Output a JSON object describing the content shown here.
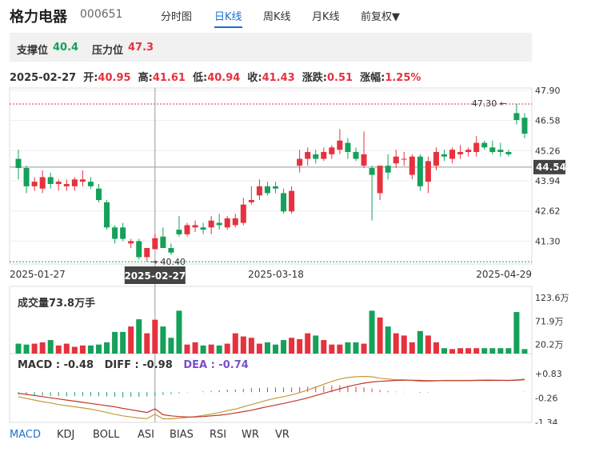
{
  "header": {
    "name": "格力电器",
    "code": "000651",
    "tabs": [
      "分时图",
      "日K线",
      "周K线",
      "月K线",
      "前复权▼"
    ],
    "active_tab": 1
  },
  "levels": {
    "support_label": "支撑位",
    "support_value": "40.4",
    "resistance_label": "压力位",
    "resistance_value": "47.3"
  },
  "info": {
    "date": "2025-02-27",
    "open_label": "开:",
    "open": "40.95",
    "high_label": "高:",
    "high": "41.61",
    "low_label": "低:",
    "low": "40.94",
    "close_label": "收:",
    "close": "41.43",
    "change_label": "涨跌:",
    "change": "0.51",
    "pct_label": "涨幅:",
    "pct": "1.25%"
  },
  "colors": {
    "up": "#e5323e",
    "down": "#15a15a",
    "dif": "#c49a3a",
    "dea": "#c0392b",
    "accent": "#1f6fd1"
  },
  "chart_data": [
    {
      "type": "candlestick",
      "y_ticks": [
        "47.90",
        "46.58",
        "45.26",
        "43.94",
        "42.62",
        "41.30"
      ],
      "ylim": [
        40.3,
        48.0
      ],
      "x_labels": [
        "2025-01-27",
        "2025-03-18",
        "2025-04-29"
      ],
      "crosshair_date": "2025-02-27",
      "crosshair_price": "44.54",
      "max_label": "47.30",
      "min_label": "40.40",
      "candles": [
        {
          "o": 44.9,
          "h": 45.3,
          "l": 44.0,
          "c": 44.5
        },
        {
          "o": 44.5,
          "h": 44.6,
          "l": 43.4,
          "c": 43.7
        },
        {
          "o": 43.7,
          "h": 44.1,
          "l": 43.5,
          "c": 43.9
        },
        {
          "o": 43.6,
          "h": 44.4,
          "l": 43.4,
          "c": 44.1
        },
        {
          "o": 44.1,
          "h": 44.3,
          "l": 43.6,
          "c": 43.8
        },
        {
          "o": 43.8,
          "h": 44.0,
          "l": 43.5,
          "c": 43.9
        },
        {
          "o": 43.7,
          "h": 44.0,
          "l": 43.5,
          "c": 43.8
        },
        {
          "o": 43.7,
          "h": 44.1,
          "l": 43.5,
          "c": 44.0
        },
        {
          "o": 43.9,
          "h": 44.4,
          "l": 43.7,
          "c": 44.0
        },
        {
          "o": 43.9,
          "h": 44.1,
          "l": 43.6,
          "c": 43.7
        },
        {
          "o": 43.6,
          "h": 43.8,
          "l": 43.0,
          "c": 43.1
        },
        {
          "o": 43.0,
          "h": 43.1,
          "l": 41.8,
          "c": 41.9
        },
        {
          "o": 41.9,
          "h": 42.0,
          "l": 41.2,
          "c": 41.4
        },
        {
          "o": 41.9,
          "h": 42.1,
          "l": 41.3,
          "c": 41.4
        },
        {
          "o": 41.2,
          "h": 41.4,
          "l": 41.0,
          "c": 41.3
        },
        {
          "o": 41.3,
          "h": 41.4,
          "l": 40.5,
          "c": 40.6
        },
        {
          "o": 40.6,
          "h": 41.0,
          "l": 40.4,
          "c": 41.0
        },
        {
          "o": 40.95,
          "h": 41.61,
          "l": 40.94,
          "c": 41.43
        },
        {
          "o": 41.5,
          "h": 41.9,
          "l": 41.0,
          "c": 41.0
        },
        {
          "o": 41.0,
          "h": 41.2,
          "l": 40.7,
          "c": 40.8
        },
        {
          "o": 41.8,
          "h": 42.4,
          "l": 41.5,
          "c": 41.6
        },
        {
          "o": 41.6,
          "h": 42.1,
          "l": 41.5,
          "c": 42.0
        },
        {
          "o": 41.9,
          "h": 42.2,
          "l": 41.7,
          "c": 42.0
        },
        {
          "o": 41.9,
          "h": 42.1,
          "l": 41.6,
          "c": 41.8
        },
        {
          "o": 41.9,
          "h": 42.4,
          "l": 41.6,
          "c": 42.2
        },
        {
          "o": 42.1,
          "h": 42.5,
          "l": 41.8,
          "c": 42.0
        },
        {
          "o": 41.9,
          "h": 42.4,
          "l": 41.8,
          "c": 42.3
        },
        {
          "o": 42.0,
          "h": 42.5,
          "l": 41.9,
          "c": 42.3
        },
        {
          "o": 42.1,
          "h": 43.2,
          "l": 42.0,
          "c": 42.9
        },
        {
          "o": 43.0,
          "h": 43.7,
          "l": 42.9,
          "c": 43.1
        },
        {
          "o": 43.3,
          "h": 44.0,
          "l": 43.1,
          "c": 43.7
        },
        {
          "o": 43.7,
          "h": 43.9,
          "l": 43.3,
          "c": 43.4
        },
        {
          "o": 43.7,
          "h": 43.9,
          "l": 43.4,
          "c": 43.6
        },
        {
          "o": 43.4,
          "h": 43.6,
          "l": 42.5,
          "c": 42.6
        },
        {
          "o": 42.6,
          "h": 43.7,
          "l": 42.5,
          "c": 43.5
        },
        {
          "o": 44.6,
          "h": 45.3,
          "l": 44.3,
          "c": 44.9
        },
        {
          "o": 44.9,
          "h": 45.4,
          "l": 44.6,
          "c": 45.2
        },
        {
          "o": 45.1,
          "h": 45.3,
          "l": 44.7,
          "c": 44.9
        },
        {
          "o": 44.9,
          "h": 45.4,
          "l": 44.8,
          "c": 45.2
        },
        {
          "o": 45.1,
          "h": 45.5,
          "l": 44.9,
          "c": 45.4
        },
        {
          "o": 45.3,
          "h": 46.2,
          "l": 45.1,
          "c": 45.7
        },
        {
          "o": 45.6,
          "h": 45.8,
          "l": 44.9,
          "c": 45.2
        },
        {
          "o": 45.2,
          "h": 45.4,
          "l": 44.8,
          "c": 44.9
        },
        {
          "o": 44.6,
          "h": 46.1,
          "l": 44.5,
          "c": 45.1
        },
        {
          "o": 44.5,
          "h": 44.6,
          "l": 42.2,
          "c": 44.2
        },
        {
          "o": 43.4,
          "h": 44.5,
          "l": 43.1,
          "c": 44.6
        },
        {
          "o": 44.6,
          "h": 45.1,
          "l": 44.0,
          "c": 44.3
        },
        {
          "o": 44.7,
          "h": 45.3,
          "l": 44.5,
          "c": 45.0
        },
        {
          "o": 44.9,
          "h": 45.2,
          "l": 44.6,
          "c": 44.9
        },
        {
          "o": 44.2,
          "h": 45.1,
          "l": 44.0,
          "c": 45.0
        },
        {
          "o": 45.0,
          "h": 45.1,
          "l": 43.5,
          "c": 43.7
        },
        {
          "o": 43.9,
          "h": 45.0,
          "l": 43.4,
          "c": 44.8
        },
        {
          "o": 44.6,
          "h": 45.4,
          "l": 44.4,
          "c": 45.2
        },
        {
          "o": 45.1,
          "h": 45.3,
          "l": 44.8,
          "c": 45.0
        },
        {
          "o": 44.9,
          "h": 45.4,
          "l": 44.7,
          "c": 45.3
        },
        {
          "o": 45.1,
          "h": 45.5,
          "l": 44.9,
          "c": 45.2
        },
        {
          "o": 45.2,
          "h": 45.4,
          "l": 45.0,
          "c": 45.3
        },
        {
          "o": 45.2,
          "h": 45.9,
          "l": 45.0,
          "c": 45.6
        },
        {
          "o": 45.6,
          "h": 45.7,
          "l": 45.3,
          "c": 45.4
        },
        {
          "o": 45.4,
          "h": 45.7,
          "l": 45.1,
          "c": 45.2
        },
        {
          "o": 45.3,
          "h": 45.6,
          "l": 45.0,
          "c": 45.2
        },
        {
          "o": 45.2,
          "h": 45.3,
          "l": 45.0,
          "c": 45.1
        },
        {
          "o": 46.9,
          "h": 47.3,
          "l": 46.4,
          "c": 46.6
        },
        {
          "o": 46.7,
          "h": 46.9,
          "l": 45.8,
          "c": 46.0
        }
      ]
    },
    {
      "type": "bar",
      "title": "成交量73.8万手",
      "y_ticks": [
        "123.6万",
        "71.9万",
        "20.2万"
      ],
      "ylim": [
        0,
        124
      ],
      "values": [
        22,
        20,
        22,
        25,
        30,
        18,
        22,
        15,
        18,
        18,
        20,
        25,
        48,
        48,
        60,
        76,
        45,
        75,
        60,
        35,
        95,
        20,
        25,
        18,
        20,
        18,
        22,
        45,
        38,
        35,
        22,
        25,
        20,
        30,
        35,
        32,
        45,
        40,
        30,
        20,
        20,
        25,
        25,
        22,
        95,
        80,
        60,
        45,
        40,
        25,
        50,
        40,
        25,
        12,
        10,
        12,
        12,
        12,
        12,
        12,
        12,
        12,
        92,
        10
      ]
    },
    {
      "type": "line",
      "title": "MACD",
      "y_ticks": [
        "+0.83",
        "-0.26",
        "-1.34"
      ],
      "ylim": [
        -1.34,
        1.0
      ],
      "series_labels": {
        "macd": "MACD : -0.48",
        "dif": "DIFF : -0.98",
        "dea": "DEA : -0.74"
      },
      "dif": [
        -0.2,
        -0.28,
        -0.35,
        -0.42,
        -0.48,
        -0.55,
        -0.6,
        -0.65,
        -0.7,
        -0.75,
        -0.82,
        -0.9,
        -0.98,
        -1.05,
        -1.1,
        -1.15,
        -1.17,
        -0.98,
        -1.18,
        -1.18,
        -1.15,
        -1.12,
        -1.08,
        -1.03,
        -0.97,
        -0.9,
        -0.82,
        -0.75,
        -0.65,
        -0.55,
        -0.45,
        -0.35,
        -0.27,
        -0.2,
        -0.12,
        -0.02,
        0.1,
        0.22,
        0.35,
        0.48,
        0.58,
        0.65,
        0.68,
        0.7,
        0.68,
        0.62,
        0.58,
        0.55,
        0.55,
        0.52,
        0.48,
        0.48,
        0.5,
        0.52,
        0.52,
        0.52,
        0.52,
        0.53,
        0.54,
        0.54,
        0.53,
        0.52,
        0.55,
        0.58
      ],
      "dea": [
        -0.05,
        -0.1,
        -0.15,
        -0.2,
        -0.25,
        -0.3,
        -0.35,
        -0.4,
        -0.45,
        -0.5,
        -0.55,
        -0.6,
        -0.65,
        -0.72,
        -0.78,
        -0.84,
        -0.9,
        -0.74,
        -1.0,
        -1.05,
        -1.08,
        -1.1,
        -1.1,
        -1.08,
        -1.05,
        -1.02,
        -0.98,
        -0.92,
        -0.86,
        -0.8,
        -0.72,
        -0.64,
        -0.57,
        -0.5,
        -0.42,
        -0.34,
        -0.25,
        -0.15,
        -0.05,
        0.05,
        0.15,
        0.25,
        0.33,
        0.4,
        0.45,
        0.48,
        0.5,
        0.52,
        0.53,
        0.53,
        0.52,
        0.51,
        0.51,
        0.51,
        0.51,
        0.51,
        0.51,
        0.52,
        0.52,
        0.52,
        0.52,
        0.52,
        0.53,
        0.55
      ],
      "macd": [
        -0.3,
        -0.35,
        -0.4,
        -0.45,
        -0.48,
        -0.5,
        -0.52,
        -0.5,
        -0.5,
        -0.5,
        -0.5,
        -0.55,
        -0.6,
        -0.65,
        -0.6,
        -0.6,
        -0.55,
        -0.48,
        -0.35,
        -0.25,
        -0.15,
        -0.04,
        0.04,
        0.1,
        0.16,
        0.24,
        0.32,
        0.34,
        0.42,
        0.5,
        0.54,
        0.58,
        0.6,
        0.6,
        0.6,
        0.64,
        0.7,
        0.74,
        0.8,
        0.86,
        0.86,
        0.8,
        0.7,
        0.6,
        0.46,
        0.28,
        0.16,
        0.06,
        0.04,
        -0.02,
        -0.08,
        -0.06,
        -0.02,
        0.02,
        0.02,
        0.02,
        0.02,
        0.02,
        0.04,
        0.04,
        0.02,
        0.0,
        0.04,
        0.06
      ]
    }
  ],
  "bottom_tabs": [
    "MACD",
    "KDJ",
    "BOLL",
    "ASI",
    "BIAS",
    "RSI",
    "WR",
    "VR"
  ]
}
